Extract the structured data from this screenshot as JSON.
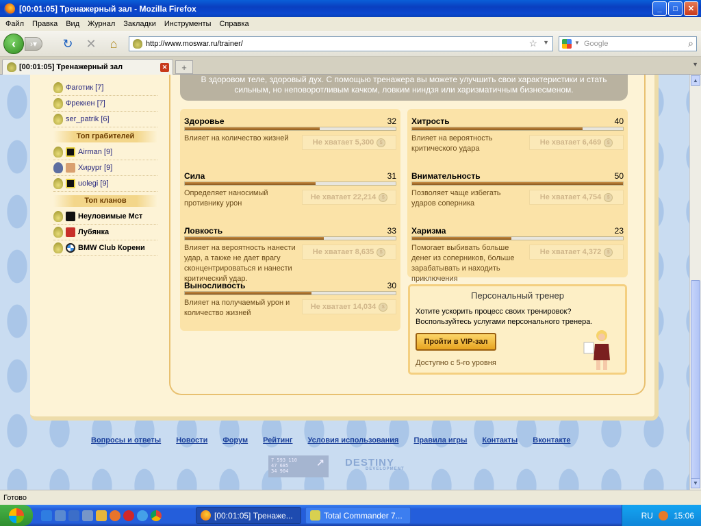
{
  "window": {
    "title": "[00:01:05] Тренажерный зал - Mozilla Firefox"
  },
  "menu": [
    "Файл",
    "Правка",
    "Вид",
    "Журнал",
    "Закладки",
    "Инструменты",
    "Справка"
  ],
  "nav": {
    "url": "http://www.moswar.ru/trainer/",
    "search_placeholder": "Google"
  },
  "tab": {
    "title": "[00:01:05] Тренажерный зал"
  },
  "intro_text": "В здоровом теле, здоровый дух. С помощью тренажера вы можете улучшить свои характеристики и стать сильным, но неповоротливым качком, ловким ниндзя или харизматичным бизнесменом.",
  "sidebar": {
    "top_list": [
      "Фаготик [7]",
      "Фреккен [7]",
      "ser_patrik [6]"
    ],
    "robbers_title": "Топ грабителей",
    "robbers": [
      "Airman [9]",
      "Хирург [9]",
      "uolegi [9]"
    ],
    "clans_title": "Топ кланов",
    "clans": [
      "Неуловимые Мст",
      "Лубянка",
      "BMW Club Корени"
    ]
  },
  "stats_left": [
    {
      "name": "Здоровье",
      "value": "32",
      "level": 0.64,
      "desc": "Влияет на количество жизней",
      "btn": "Не хватает 5,300"
    },
    {
      "name": "Сила",
      "value": "31",
      "level": 0.62,
      "desc": "Определяет наносимый противнику урон",
      "btn": "Не хватает 22,214"
    },
    {
      "name": "Ловкость",
      "value": "33",
      "level": 0.66,
      "desc": "Влияет на вероятность нанести удар, а также не дает врагу сконцентрироваться и нанести критический удар.",
      "btn": "Не хватает 8,635"
    },
    {
      "name": "Выносливость",
      "value": "30",
      "level": 0.6,
      "desc": "Влияет на получаемый урон и количество жизней",
      "btn": "Не хватает 14,034"
    }
  ],
  "stats_right": [
    {
      "name": "Хитрость",
      "value": "40",
      "level": 0.81,
      "desc": "Влияет на вероятность критического удара",
      "btn": "Не хватает 6,469"
    },
    {
      "name": "Внимательность",
      "value": "50",
      "level": 1.0,
      "desc": "Позволяет чаще избегать ударов соперника",
      "btn": "Не хватает 4,754"
    },
    {
      "name": "Харизма",
      "value": "23",
      "level": 0.47,
      "desc": "Помогает выбивать больше денег из соперников, больше зарабатывать и находить приключения",
      "btn": "Не хватает 4,372"
    }
  ],
  "trainer": {
    "title": "Персональный тренер",
    "text": "Хотите ускорить процесс своих тренировок? Воспользуйтесь услугами персонального тренера.",
    "button": "Пройти в VIP-зал",
    "note": "Доступно с 5-го уровня"
  },
  "footer": {
    "links": [
      "Вопросы и ответы",
      "Новости",
      "Форум",
      "Рейтинг",
      "Условия использования",
      "Правила игры",
      "Контакты",
      "Вконтакте"
    ],
    "counter": [
      "7 593 110",
      "47 685",
      "34 904"
    ],
    "brand": "DESTINY",
    "brand_sub": "DEVELOPMENT"
  },
  "status": "Готово",
  "taskbar": {
    "tasks": [
      "[00:01:05] Тренаже...",
      "Total Commander 7..."
    ],
    "lang": "RU",
    "clock": "15:06"
  }
}
